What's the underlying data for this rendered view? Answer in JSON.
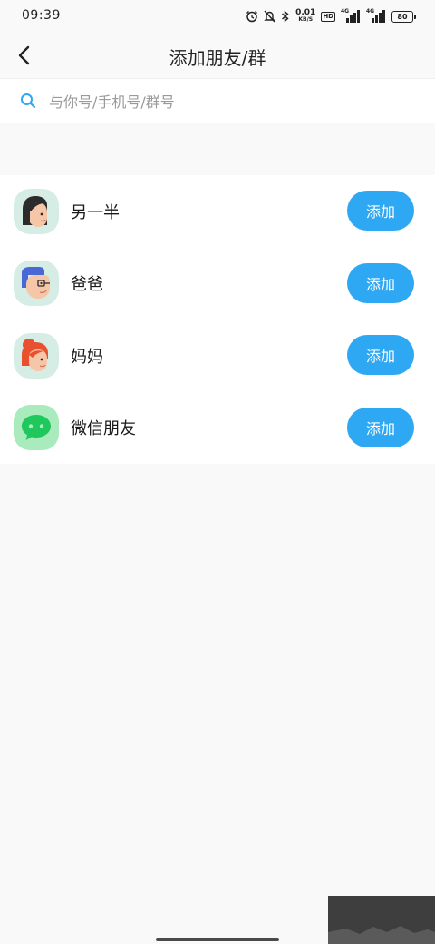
{
  "status_bar": {
    "time": "09:39",
    "net_speed_value": "0.01",
    "net_speed_unit": "KB/S",
    "hd_badge": "HD",
    "signal1_label": "4G",
    "signal2_label": "4G",
    "battery_level": "80",
    "icons": [
      "alarm-icon",
      "mute-icon",
      "bluetooth-icon",
      "hd-icon",
      "signal-icon",
      "signal-icon",
      "battery-icon"
    ]
  },
  "navbar": {
    "title": "添加朋友/群",
    "back_icon": "chevron-left-icon"
  },
  "search": {
    "placeholder": "与你号/手机号/群号",
    "icon": "search-icon"
  },
  "contacts": [
    {
      "label": "另一半",
      "button": "添加",
      "icon": "avatar-partner-icon"
    },
    {
      "label": "爸爸",
      "button": "添加",
      "icon": "avatar-dad-icon"
    },
    {
      "label": "妈妈",
      "button": "添加",
      "icon": "avatar-mom-icon"
    },
    {
      "label": "微信朋友",
      "button": "添加",
      "icon": "wechat-icon"
    }
  ],
  "colors": {
    "accent": "#2ea8f2",
    "background": "#f9f9f9",
    "card": "#ffffff",
    "avatar_bg": "#d6ede6",
    "wechat_bg": "#a9ebbc"
  }
}
